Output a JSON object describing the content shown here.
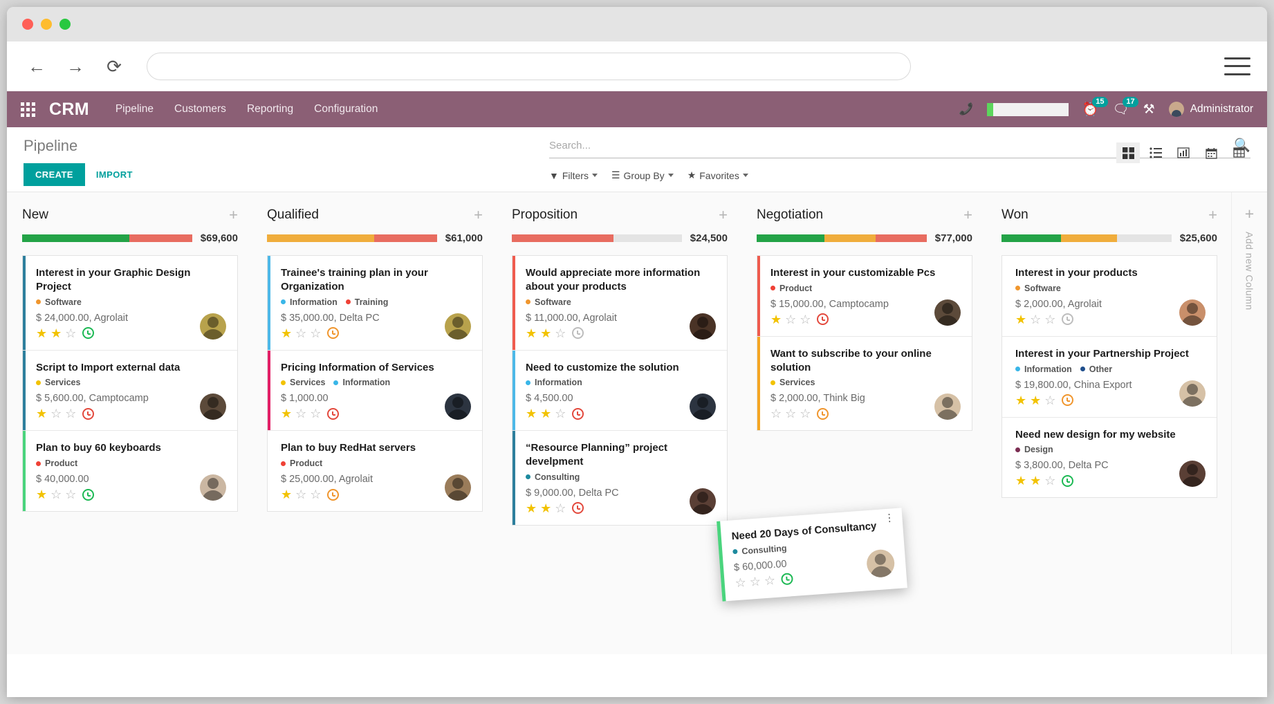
{
  "browser": {
    "back_icon": "back-arrow-icon",
    "forward_icon": "forward-arrow-icon",
    "reload_icon": "reload-icon",
    "url_value": "",
    "url_placeholder": "",
    "menu_icon": "hamburger-menu-icon"
  },
  "navbar": {
    "brand": "CRM",
    "links": [
      "Pipeline",
      "Customers",
      "Reporting",
      "Configuration"
    ],
    "phone_icon": "phone-icon",
    "activity_badge": "15",
    "messages_badge": "17",
    "tools_icon": "wrench-screwdriver-icon",
    "user_name": "Administrator",
    "accent_color": "#8b5f75",
    "badge_color": "#00a09d"
  },
  "control_panel": {
    "title": "Pipeline",
    "create_label": "CREATE",
    "import_label": "IMPORT",
    "search_value": "",
    "search_placeholder": "Search...",
    "filters_label": "Filters",
    "group_by_label": "Group By",
    "favorites_label": "Favorites",
    "views": [
      {
        "name": "kanban-view-button",
        "icon": "kanban-icon",
        "active": true
      },
      {
        "name": "list-view-button",
        "icon": "list-icon",
        "active": false
      },
      {
        "name": "graph-view-button",
        "icon": "bar-chart-icon",
        "active": false
      },
      {
        "name": "calendar-view-button",
        "icon": "calendar-icon",
        "active": false
      },
      {
        "name": "pivot-view-button",
        "icon": "pivot-table-icon",
        "active": false
      }
    ]
  },
  "add_column": {
    "plus": "+",
    "label": "Add new Column"
  },
  "columns": [
    {
      "title": "New",
      "amount": "$69,600",
      "progress": [
        {
          "color": "#23a347",
          "pct": 63
        },
        {
          "color": "#e86c60",
          "pct": 37
        }
      ],
      "cards": [
        {
          "title": "Interest in your Graphic Design Project",
          "stripe": "#2d7f9d",
          "tags": [
            {
              "label": "Software",
              "color": "#f0962e"
            }
          ],
          "amount": "$ 24,000.00, Agrolait",
          "stars": 2,
          "clock": "#1db954",
          "avatar_color": "#b8a24c"
        },
        {
          "title": "Script to Import external data",
          "stripe": "#2d7f9d",
          "tags": [
            {
              "label": "Services",
              "color": "#f2c200"
            }
          ],
          "amount": "$ 5,600.00, Camptocamp",
          "stars": 1,
          "clock": "#e3493d",
          "avatar_color": "#5c4a3a"
        },
        {
          "title": "Plan to buy 60 keyboards",
          "stripe": "#4ad47d",
          "tags": [
            {
              "label": "Product",
              "color": "#ef4136"
            }
          ],
          "amount": "$ 40,000.00",
          "stars": 1,
          "clock": "#1db954",
          "avatar_color": "#cbb7a2"
        }
      ]
    },
    {
      "title": "Qualified",
      "amount": "$61,000",
      "progress": [
        {
          "color": "#f0ad3c",
          "pct": 63
        },
        {
          "color": "#e86c60",
          "pct": 37
        }
      ],
      "cards": [
        {
          "title": "Trainee's training plan in your Organization",
          "stripe": "#4db8e8",
          "tags": [
            {
              "label": "Information",
              "color": "#39b6e8"
            },
            {
              "label": "Training",
              "color": "#ef4136"
            }
          ],
          "amount": "$ 35,000.00, Delta PC",
          "stars": 1,
          "clock": "#f0962e",
          "avatar_color": "#b8a24c"
        },
        {
          "title": "Pricing Information of Services",
          "stripe": "#e31f66",
          "tags": [
            {
              "label": "Services",
              "color": "#f2c200"
            },
            {
              "label": "Information",
              "color": "#39b6e8"
            }
          ],
          "amount": "$ 1,000.00",
          "stars": 1,
          "clock": "#e3493d",
          "avatar_color": "#2c3440"
        },
        {
          "title": "Plan to buy RedHat servers",
          "stripe": "#ffffff",
          "tags": [
            {
              "label": "Product",
              "color": "#ef4136"
            }
          ],
          "amount": "$ 25,000.00, Agrolait",
          "stars": 1,
          "clock": "#f0962e",
          "avatar_color": "#9a7c5a"
        }
      ]
    },
    {
      "title": "Proposition",
      "amount": "$24,500",
      "progress": [
        {
          "color": "#e86c60",
          "pct": 60
        },
        {
          "color": "#e4e4e4",
          "pct": 40
        }
      ],
      "cards": [
        {
          "title": "Would appreciate more information about your products",
          "stripe": "#ef5b4e",
          "tags": [
            {
              "label": "Software",
              "color": "#f0962e"
            }
          ],
          "amount": "$ 11,000.00, Agrolait",
          "stars": 2,
          "clock": "#bdbdbd",
          "avatar_color": "#4a3326"
        },
        {
          "title": "Need to customize the solution",
          "stripe": "#4db8e8",
          "tags": [
            {
              "label": "Information",
              "color": "#39b6e8"
            }
          ],
          "amount": "$ 4,500.00",
          "stars": 2,
          "clock": "#e3493d",
          "avatar_color": "#2c3440"
        },
        {
          "title": "“Resource Planning” project develpment",
          "stripe": "#2d7f9d",
          "tags": [
            {
              "label": "Consulting",
              "color": "#1d8a9e"
            }
          ],
          "amount": "$ 9,000.00, Delta PC",
          "stars": 2,
          "clock": "#e3493d",
          "avatar_color": "#5a3f35"
        }
      ]
    },
    {
      "title": "Negotiation",
      "amount": "$77,000",
      "progress": [
        {
          "color": "#23a347",
          "pct": 40
        },
        {
          "color": "#f0ad3c",
          "pct": 30
        },
        {
          "color": "#e86c60",
          "pct": 30
        }
      ],
      "cards": [
        {
          "title": "Interest in your customizable Pcs",
          "stripe": "#ef5b4e",
          "tags": [
            {
              "label": "Product",
              "color": "#ef4136"
            }
          ],
          "amount": "$ 15,000.00, Camptocamp",
          "stars": 1,
          "clock": "#e3493d",
          "avatar_color": "#5c4a3a"
        },
        {
          "title": "Want to subscribe to your online solution",
          "stripe": "#f5a623",
          "tags": [
            {
              "label": "Services",
              "color": "#f2c200"
            }
          ],
          "amount": "$ 2,000.00, Think Big",
          "stars": 0,
          "clock": "#f0962e",
          "avatar_color": "#d6c1a6"
        }
      ]
    },
    {
      "title": "Won",
      "amount": "$25,600",
      "progress": [
        {
          "color": "#23a347",
          "pct": 35
        },
        {
          "color": "#f0ad3c",
          "pct": 33
        },
        {
          "color": "#e4e4e4",
          "pct": 32
        }
      ],
      "cards": [
        {
          "title": "Interest in your products",
          "stripe": "#ffffff",
          "tags": [
            {
              "label": "Software",
              "color": "#f0962e"
            }
          ],
          "amount": "$ 2,000.00, Agrolait",
          "stars": 1,
          "clock": "#bdbdbd",
          "avatar_color": "#c98f6a"
        },
        {
          "title": "Interest in your Partnership Project",
          "stripe": "#ffffff",
          "tags": [
            {
              "label": "Information",
              "color": "#39b6e8"
            },
            {
              "label": "Other",
              "color": "#1f4e8c"
            }
          ],
          "amount": "$ 19,800.00, China Export",
          "stars": 2,
          "clock": "#f0962e",
          "avatar_color": "#d6c1a6"
        },
        {
          "title": "Need new design for my website",
          "stripe": "#ffffff",
          "tags": [
            {
              "label": "Design",
              "color": "#7b2d52"
            }
          ],
          "amount": "$ 3,800.00, Delta PC",
          "stars": 2,
          "clock": "#1db954",
          "avatar_color": "#5a3f35"
        }
      ]
    }
  ],
  "drag_card": {
    "title": "Need 20 Days of Consultancy",
    "tags": [
      {
        "label": "Consulting",
        "color": "#1d8a9e"
      }
    ],
    "amount": "$ 60,000.00",
    "stars": 0,
    "clock": "#1db954",
    "menu_icon": "kebab-menu-icon"
  }
}
